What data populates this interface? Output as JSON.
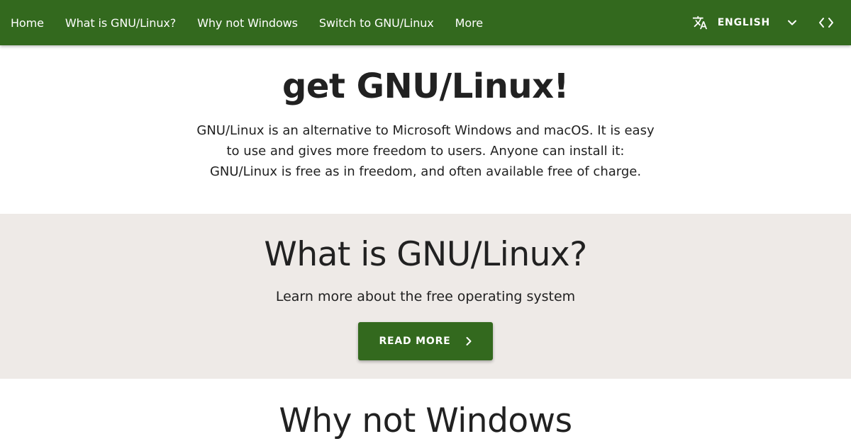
{
  "nav": {
    "links": [
      "Home",
      "What is GNU/Linux?",
      "Why not Windows",
      "Switch to GNU/Linux",
      "More"
    ],
    "language_label": "ENGLISH",
    "icons": {
      "language": "translate-icon",
      "language_dropdown": "chevron-down-icon",
      "source": "code-icon"
    },
    "color": "#33691e"
  },
  "hero": {
    "title": "get GNU/Linux!",
    "lines": [
      "GNU/Linux is an alternative to Microsoft Windows and macOS. It is easy",
      "to use and gives more freedom to users. Anyone can install it:",
      "GNU/Linux is free as in freedom, and often available free of charge."
    ]
  },
  "what_is": {
    "title": "What is GNU/Linux?",
    "subtitle": "Learn more about the free operating system",
    "button_label": "READ MORE",
    "button_icon": "chevron-right-icon",
    "background": "#eeeae7"
  },
  "why_not": {
    "title": "Why not Windows"
  }
}
